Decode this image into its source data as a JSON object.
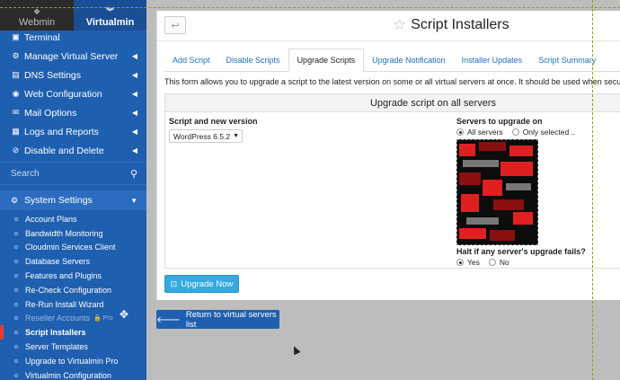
{
  "sidebar": {
    "tab_webmin": "Webmin",
    "tab_virtualmin": "Virtualmin",
    "nav": [
      {
        "label": "Terminal",
        "icon": "terminal-icon"
      },
      {
        "label": "Manage Virtual Server",
        "icon": "gears-icon"
      },
      {
        "label": "DNS Settings",
        "icon": "dns-icon"
      },
      {
        "label": "Web Configuration",
        "icon": "globe-icon"
      },
      {
        "label": "Mail Options",
        "icon": "mail-icon"
      },
      {
        "label": "Logs and Reports",
        "icon": "logs-icon"
      },
      {
        "label": "Disable and Delete",
        "icon": "disable-icon"
      }
    ],
    "search_placeholder": "Search",
    "system_settings": "System Settings",
    "sub_items": [
      "Account Plans",
      "Bandwidth Monitoring",
      "Cloudmin Services Client",
      "Database Servers",
      "Features and Plugins",
      "Re-Check Configuration",
      "Re-Run Install Wizard",
      "Reseller Accounts",
      "Script Installers",
      "Server Templates",
      "Upgrade to Virtualmin Pro",
      "Virtualmin Configuration"
    ],
    "pro_tag": "Pro",
    "active_item": "Script Installers"
  },
  "page": {
    "title": "Script Installers",
    "tabs": [
      "Add Script",
      "Disable Scripts",
      "Upgrade Scripts",
      "Upgrade Notification",
      "Installer Updates",
      "Script Summary"
    ],
    "active_tab": "Upgrade Scripts",
    "intro": "This form allows you to upgrade a script to the latest version on some or all virtual servers at once. It should be used when security prob",
    "box_title": "Upgrade script on all servers",
    "script_label": "Script and new version",
    "script_value": "WordPress 6.5.2",
    "servers_label": "Servers to upgrade on",
    "servers_all": "All servers",
    "servers_selected": "Only selected ..",
    "halt_label": "Halt if any server's upgrade fails?",
    "halt_yes": "Yes",
    "halt_no": "No",
    "upgrade_button": "Upgrade Now",
    "return_button": "Return to virtual servers list"
  },
  "colors": {
    "sidebar_bg": "#1f5fb0",
    "accent": "#35a9e0",
    "active_marker": "#e53935"
  }
}
